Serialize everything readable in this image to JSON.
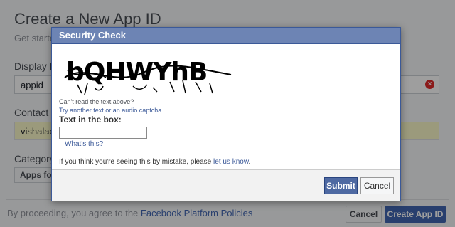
{
  "background": {
    "title": "Create a New App ID",
    "subtitle": "Get starte",
    "display_name_label": "Display N",
    "display_name_value": "appid",
    "contact_label": "Contact E",
    "contact_value": "vishalac",
    "category_label": "Category",
    "category_value": "Apps for",
    "footer_text": "By proceeding, you agree to the ",
    "footer_link": "Facebook Platform Policies",
    "cancel_label": "Cancel",
    "create_label": "Create App ID"
  },
  "dialog": {
    "title": "Security Check",
    "captcha_text": "bQHWYhB",
    "cant_read": "Can't read the text above?",
    "try_prefix": "Try ",
    "try_link": "another text",
    "try_middle": " or ",
    "audio_link": "an audio captcha",
    "input_label": "Text in the box:",
    "input_value": "",
    "whats_this": "What's this?",
    "mistake_text": "If you think you're seeing this by mistake, please ",
    "let_us_know": "let us know",
    "mistake_end": ".",
    "submit_label": "Submit",
    "cancel_label": "Cancel"
  },
  "colors": {
    "header_bg": "#6d84b4",
    "primary": "#4267b2",
    "link": "#3b5998"
  }
}
